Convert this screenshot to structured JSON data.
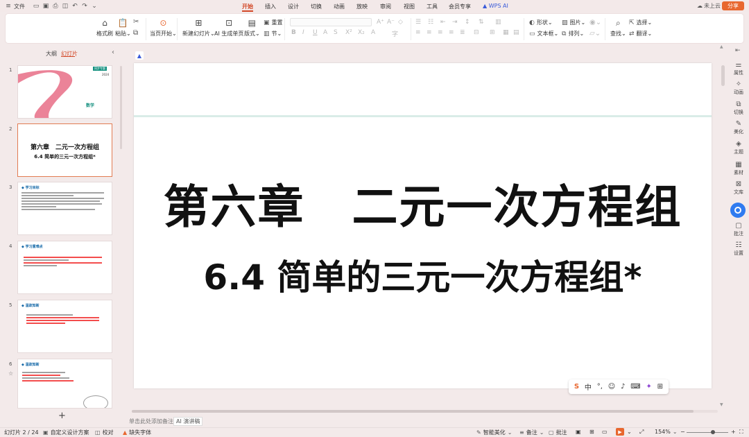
{
  "quick_access": {
    "file_label": "文件",
    "icons": [
      "folder-icon",
      "save-icon",
      "print-icon",
      "preview-icon",
      "undo-icon",
      "redo-icon",
      "dropdown-icon"
    ]
  },
  "menu": {
    "tabs": [
      "开始",
      "插入",
      "设计",
      "切换",
      "动画",
      "放映",
      "审阅",
      "视图",
      "工具",
      "会员专享",
      "WPS AI"
    ],
    "active_tab": "开始"
  },
  "header_right": {
    "cloud_label": "未上云",
    "share_label": "分享"
  },
  "ribbon": {
    "format_painter": "格式刷",
    "paste": "粘贴",
    "play_from_current": "当页开始",
    "new_slide": "新建幻灯片",
    "ai_generate": "AI 生成单页",
    "layout": "版式",
    "reset": "重置",
    "section": "节",
    "shape": "形状",
    "picture": "图片",
    "textbox": "文本框",
    "arrange": "排列",
    "find": "查找",
    "select": "选择",
    "translate": "翻译"
  },
  "left_panel": {
    "tab_outline": "大纲",
    "tab_slides": "幻灯片",
    "thumbnails": [
      {
        "num": "1",
        "title": "数学",
        "badge": "同步专题",
        "year": "2024"
      },
      {
        "num": "2",
        "title": "第六章　二元一次方程组",
        "subtitle": "6.4 简单的三元一次方程组*"
      },
      {
        "num": "3",
        "heading": "学习目标"
      },
      {
        "num": "4",
        "heading": "学习重难点"
      },
      {
        "num": "5",
        "heading": "温故知新"
      },
      {
        "num": "6",
        "heading": "温故知新"
      }
    ]
  },
  "slide": {
    "title": "第六章　二元一次方程组",
    "subtitle": "6.4 简单的三元一次方程组*"
  },
  "notes": {
    "hint": "单击此处添加备注",
    "speaker_notes": "AI 演讲稿"
  },
  "right_sidebar": [
    "属性",
    "动画",
    "切换",
    "美化",
    "主题",
    "素材",
    "文库",
    "批注",
    "设置"
  ],
  "status_bar": {
    "slide_counter": "幻灯片 2 / 24",
    "design_scheme": "自定义设计方案",
    "proofread": "校对",
    "missing_font": "缺失字体",
    "smart_beautify": "智能美化",
    "notes": "备注",
    "comments": "批注",
    "zoom": "154%"
  },
  "colors": {
    "accent": "#d24726",
    "share": "#e8672f",
    "ai_blue": "#2f7bf0"
  }
}
